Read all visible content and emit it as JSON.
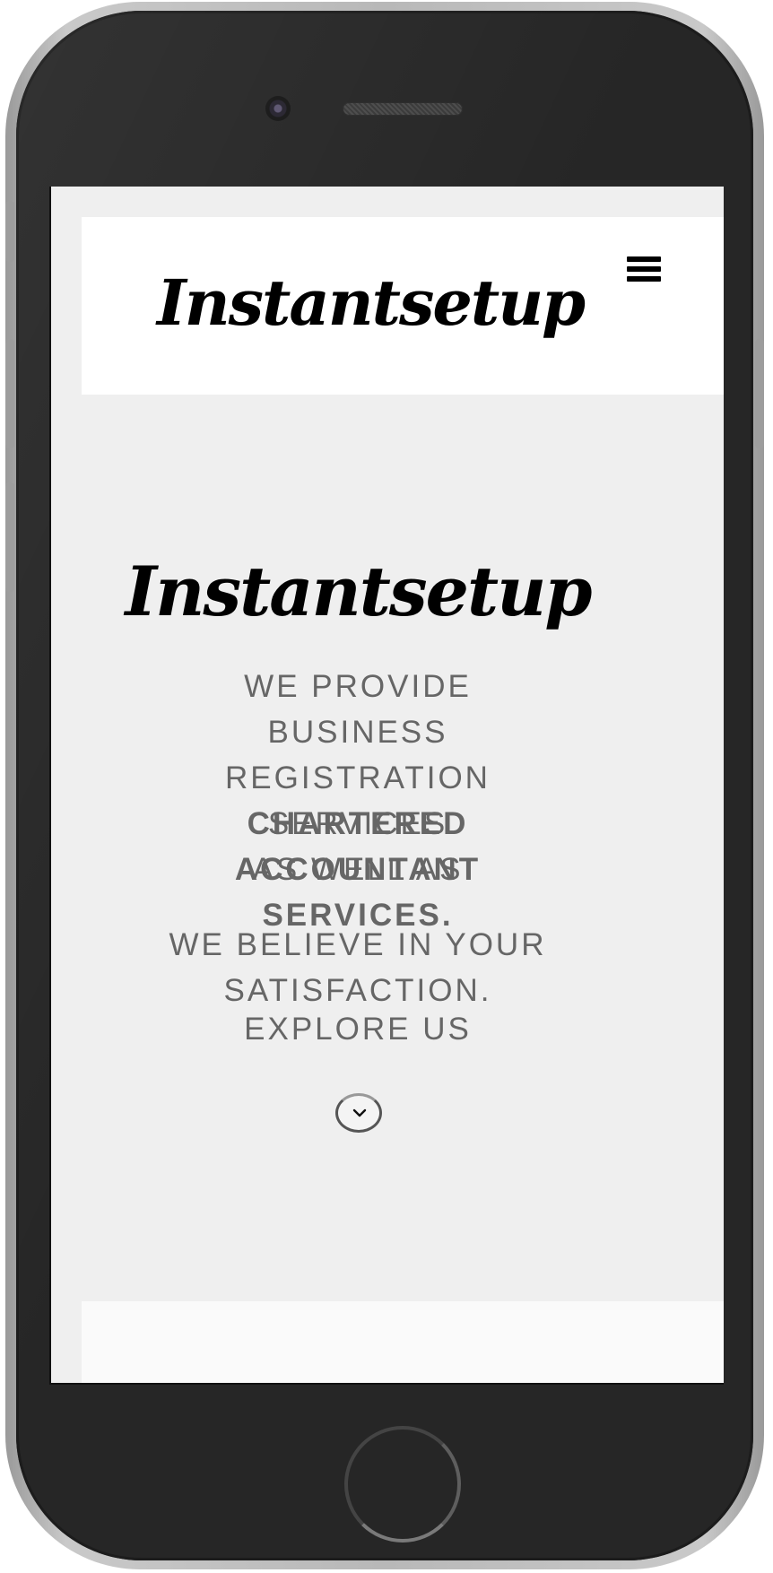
{
  "header": {
    "logo_text": "Instantsetup",
    "menu_icon": "hamburger-menu-icon"
  },
  "hero": {
    "logo_text": "Instantsetup",
    "tagline_lines": [
      "WE PROVIDE BUSINESS",
      "REGISTRATION SERVICES",
      "AS WELL AS"
    ],
    "tagline_strong_lines": [
      "CHARTERED ACCOUNTANT",
      "SERVICES."
    ],
    "belief_lines": [
      "WE BELIEVE IN YOUR",
      "SATISFACTION."
    ],
    "explore_label": "EXPLORE US",
    "scroll_icon": "chevron-down-icon"
  },
  "colors": {
    "page_background": "#efefef",
    "header_background": "#ffffff",
    "text_gray": "#666666",
    "logo_black": "#000000",
    "phone_body": "#262626"
  }
}
